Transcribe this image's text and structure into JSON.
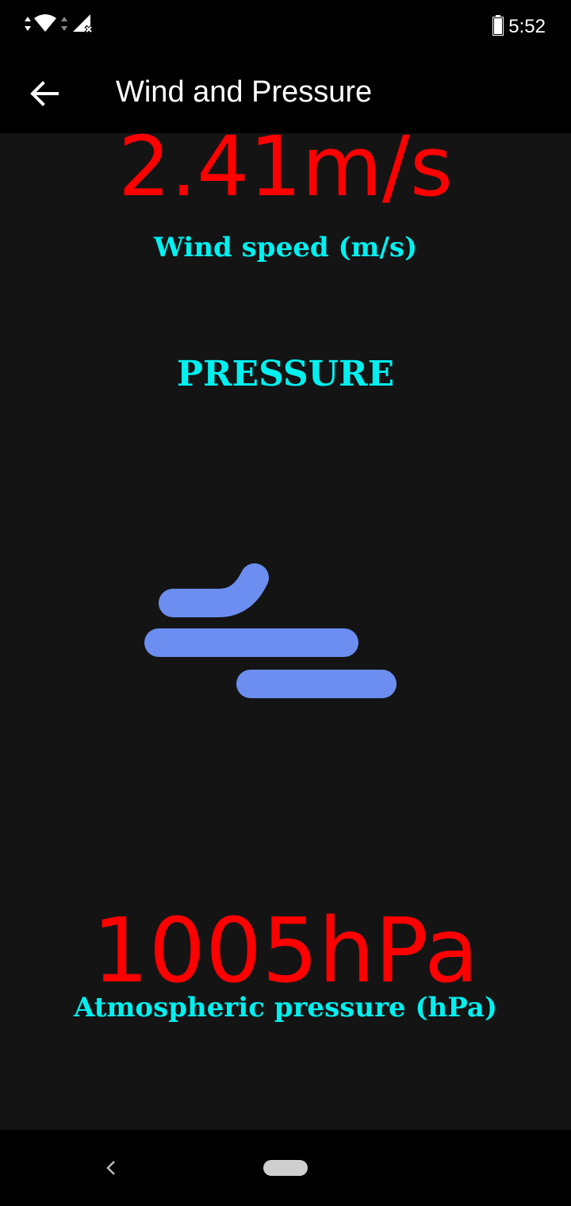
{
  "status_bar": {
    "time": "5:52",
    "icons": [
      "data-arrows-icon",
      "wifi-icon",
      "data-arrows-icon",
      "signal-no-service-icon",
      "battery-icon"
    ]
  },
  "app_bar": {
    "title": "Wind and Pressure",
    "back_icon": "arrow-left-icon"
  },
  "wind": {
    "value": "2.41m/s",
    "label": "Wind speed (m/s)"
  },
  "pressure": {
    "heading": "PRESSURE",
    "icon": "wind-icon",
    "value": "1005hPa",
    "label": "Atmospheric pressure (hPa)"
  },
  "colors": {
    "background": "#141414",
    "value_text": "#ff0000",
    "label_text": "#00f0f0",
    "icon": "#6b8ef0"
  },
  "nav_bar": {
    "back_icon": "nav-back-icon",
    "home_icon": "home-pill-icon"
  }
}
